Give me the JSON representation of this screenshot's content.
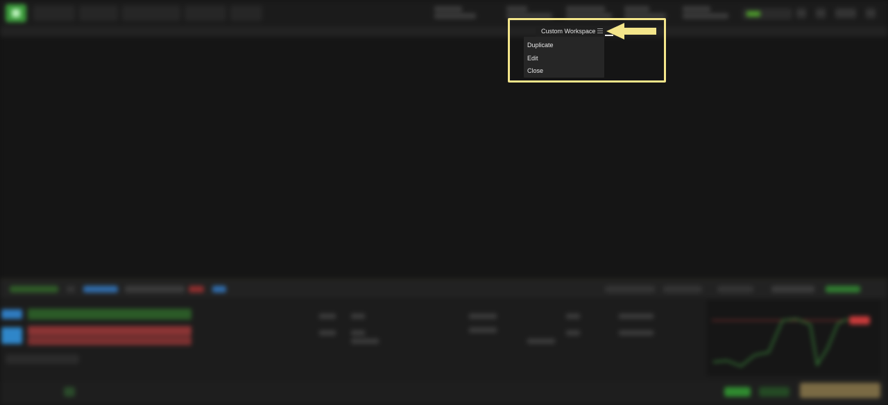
{
  "workspace_tab": {
    "title": "Custom Workspace",
    "menu_icon": "hamburger-icon"
  },
  "context_menu": {
    "items": [
      {
        "label": "Duplicate"
      },
      {
        "label": "Edit"
      },
      {
        "label": "Close"
      }
    ]
  },
  "annotation": {
    "highlight_color": "#f3e58a",
    "arrow_icon": "left-arrow-icon"
  },
  "theme": {
    "background": "#141414",
    "accent_green": "#3a9a3a",
    "sell_red": "#8a3434",
    "buy_blue": "#2f7bbf"
  }
}
